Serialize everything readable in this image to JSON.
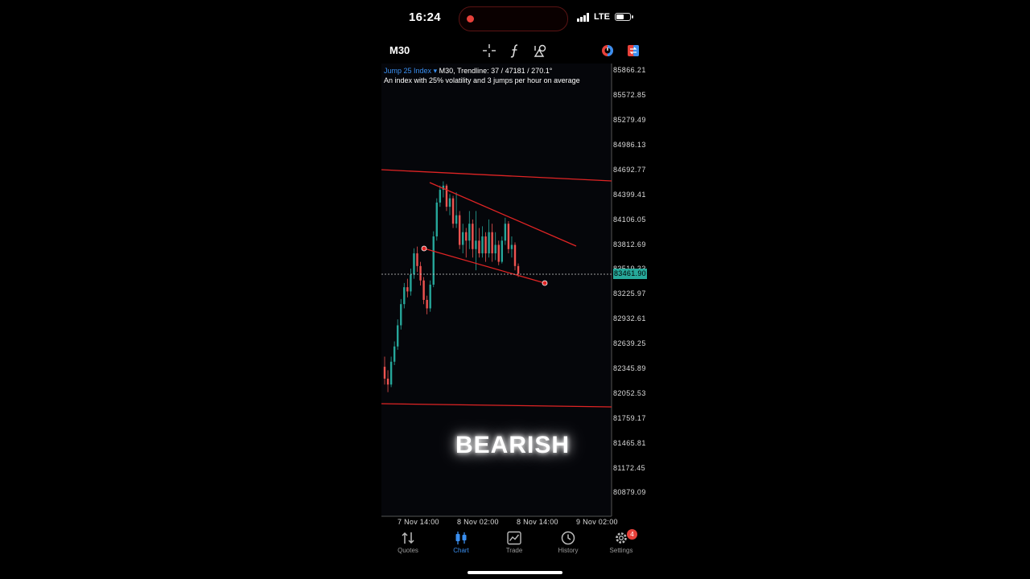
{
  "status_bar": {
    "time": "16:24",
    "network": "LTE"
  },
  "toolbar": {
    "timeframe": "M30",
    "icons": [
      "crosshair-icon",
      "function-icon",
      "objects-icon",
      "chart-type-icon",
      "swap-icon"
    ]
  },
  "chart": {
    "symbol": "Jump 25 Index",
    "symbol_caret": "▾",
    "info": "M30, Trendline: 37 / 47181 / 270.1°",
    "description": "An index with 25% volatility and 3 jumps per hour on average",
    "current_price": "83461.90",
    "price_axis": [
      "85866.21",
      "85572.85",
      "85279.49",
      "84986.13",
      "84692.77",
      "84399.41",
      "84106.05",
      "83812.69",
      "83519.33",
      "83225.97",
      "82932.61",
      "82639.25",
      "82345.89",
      "82052.53",
      "81759.17",
      "81465.81",
      "81172.45",
      "80879.09"
    ],
    "time_axis": [
      "7 Nov 14:00",
      "8 Nov 02:00",
      "8 Nov 14:00",
      "9 Nov 02:00"
    ],
    "overlay_text": "BEARISH",
    "colors": {
      "bull": "#26a69a",
      "bear": "#ef5350",
      "trendline": "#e02424",
      "accent": "#3a8ff0"
    }
  },
  "chart_data": {
    "type": "candlestick",
    "symbol": "Jump 25 Index",
    "timeframe": "M30",
    "y_range": [
      80879.09,
      85866.21
    ],
    "x_ticks": [
      "7 Nov 14:00",
      "8 Nov 02:00",
      "8 Nov 14:00",
      "9 Nov 02:00"
    ],
    "last_price": 83461.9,
    "candles": [
      [
        82360,
        82220,
        82480,
        82150
      ],
      [
        82220,
        82150,
        82320,
        82060
      ],
      [
        82150,
        82420,
        82480,
        82120
      ],
      [
        82420,
        82600,
        82660,
        82380
      ],
      [
        82600,
        82850,
        82920,
        82560
      ],
      [
        82850,
        83100,
        83160,
        82800
      ],
      [
        83100,
        83300,
        83350,
        83050
      ],
      [
        83300,
        83250,
        83400,
        83180
      ],
      [
        83250,
        83450,
        83520,
        83200
      ],
      [
        83450,
        83700,
        83760,
        83400
      ],
      [
        83700,
        83550,
        83780,
        83480
      ],
      [
        83550,
        83380,
        83600,
        83320
      ],
      [
        83380,
        83150,
        83420,
        83100
      ],
      [
        83150,
        83050,
        83200,
        82980
      ],
      [
        83050,
        83330,
        83380,
        83010
      ],
      [
        83330,
        83900,
        83960,
        83300
      ],
      [
        83900,
        84300,
        84350,
        83850
      ],
      [
        84300,
        84450,
        84500,
        84250
      ],
      [
        84450,
        84500,
        84550,
        84360
      ],
      [
        84500,
        84250,
        84520,
        84200
      ],
      [
        84250,
        84350,
        84400,
        84150
      ],
      [
        84350,
        84050,
        84380,
        84000
      ],
      [
        84050,
        84150,
        84420,
        84000
      ],
      [
        84150,
        83800,
        84200,
        83750
      ],
      [
        83800,
        83950,
        84050,
        83700
      ],
      [
        83950,
        83850,
        84000,
        83650
      ],
      [
        83850,
        84050,
        84200,
        83750
      ],
      [
        84050,
        83750,
        84100,
        83650
      ],
      [
        83750,
        83850,
        84200,
        83500
      ],
      [
        83850,
        83700,
        84000,
        83650
      ],
      [
        83700,
        83900,
        84020,
        83650
      ],
      [
        83900,
        83700,
        83950,
        83600
      ],
      [
        83700,
        83950,
        84100,
        83650
      ],
      [
        83950,
        83700,
        84050,
        83600
      ],
      [
        83700,
        83800,
        83950,
        83620
      ],
      [
        83800,
        83600,
        83850,
        83560
      ],
      [
        83600,
        83850,
        83900,
        83580
      ],
      [
        83850,
        84050,
        84120,
        83800
      ],
      [
        84050,
        83750,
        84080,
        83700
      ],
      [
        83750,
        83800,
        83900,
        83650
      ],
      [
        83800,
        83550,
        83830,
        83500
      ],
      [
        83550,
        83460,
        83580,
        83420
      ]
    ]
  },
  "nav": {
    "items": [
      {
        "label": "Quotes",
        "icon": "quotes-icon"
      },
      {
        "label": "Chart",
        "icon": "chart-icon"
      },
      {
        "label": "Trade",
        "icon": "trade-icon"
      },
      {
        "label": "History",
        "icon": "history-icon"
      },
      {
        "label": "Settings",
        "icon": "settings-icon"
      }
    ],
    "active": "Chart",
    "settings_badge": "4"
  }
}
